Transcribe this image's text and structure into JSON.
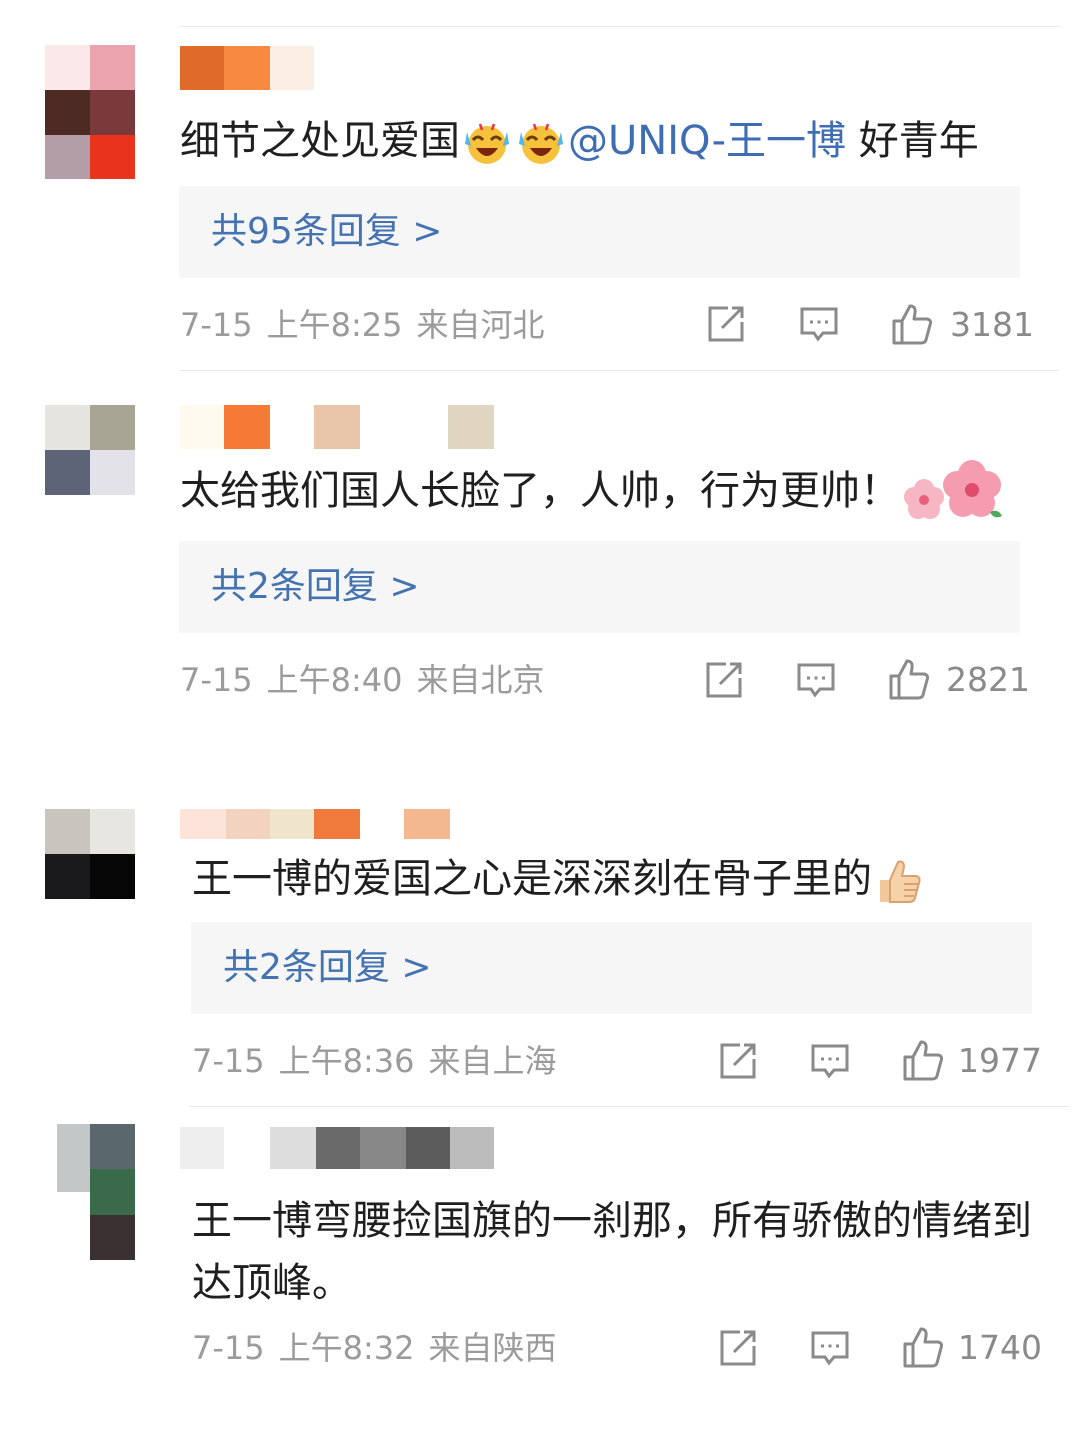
{
  "comments": [
    {
      "text_before": "细节之处见爱国",
      "emojis": [
        "laughing-crying-emoji",
        "laughing-crying-emoji"
      ],
      "mention": "@UNIQ-王一博",
      "text_after": " 好青年",
      "reply_label": "共95条回复 >",
      "date": "7-15",
      "time": "上午8:25",
      "location": "来自河北",
      "likes": "3181",
      "avatar_colors": [
        "#fbe9ea",
        "#eba4ae",
        "#4d2b24",
        "#7a3a3c",
        "#b39ea8",
        "#e8341c"
      ],
      "name_colors": [
        "#e06a28",
        "#f78a40",
        "#fbeee4"
      ]
    },
    {
      "text": "太给我们国人长脸了，人帅，行为更帅！",
      "emoji": "flower-emoji",
      "reply_label": "共2条回复 >",
      "date": "7-15",
      "time": "上午8:40",
      "location": "来自北京",
      "likes": "2821",
      "avatar_colors": [
        "#e6e4de",
        "#a8a595",
        "#5d6477",
        "#e2e2e8"
      ],
      "name_colors": [
        "#fffaf0",
        "#f47a35",
        "#e8c5a8",
        "#e0d6c0"
      ]
    },
    {
      "text": "王一博的爱国之心是深深刻在骨子里的",
      "emoji": "thumbs-up-emoji",
      "reply_label": "共2条回复 >",
      "date": "7-15",
      "time": "上午8:36",
      "location": "来自上海",
      "likes": "1977",
      "avatar_colors": [
        "#c7c5bd",
        "#e8e6e0",
        "#1a1a1c",
        "#060606"
      ],
      "name_colors": [
        "#fde4da",
        "#f2d3c0",
        "#f0e4cc",
        "#ef7a3c",
        "#f4b890"
      ]
    },
    {
      "text": "王一博弯腰捡国旗的一刹那，所有骄傲的情绪到达顶峰。",
      "date": "7-15",
      "time": "上午8:32",
      "location": "来自陕西",
      "likes": "1740",
      "avatar_colors": [
        "#c3c7c8",
        "#5a676c",
        "#ffffff",
        "#3a6a4a",
        "#ffffff",
        "#3a3032"
      ],
      "name_colors": [
        "#eeeeee",
        "#dddddd",
        "#6a6a6a",
        "#888888",
        "#5c5c5c",
        "#bcbcbc"
      ]
    }
  ],
  "colors": {
    "link": "#4473b0",
    "meta": "#9b9b9b",
    "reply_bg": "#f6f6f7"
  }
}
